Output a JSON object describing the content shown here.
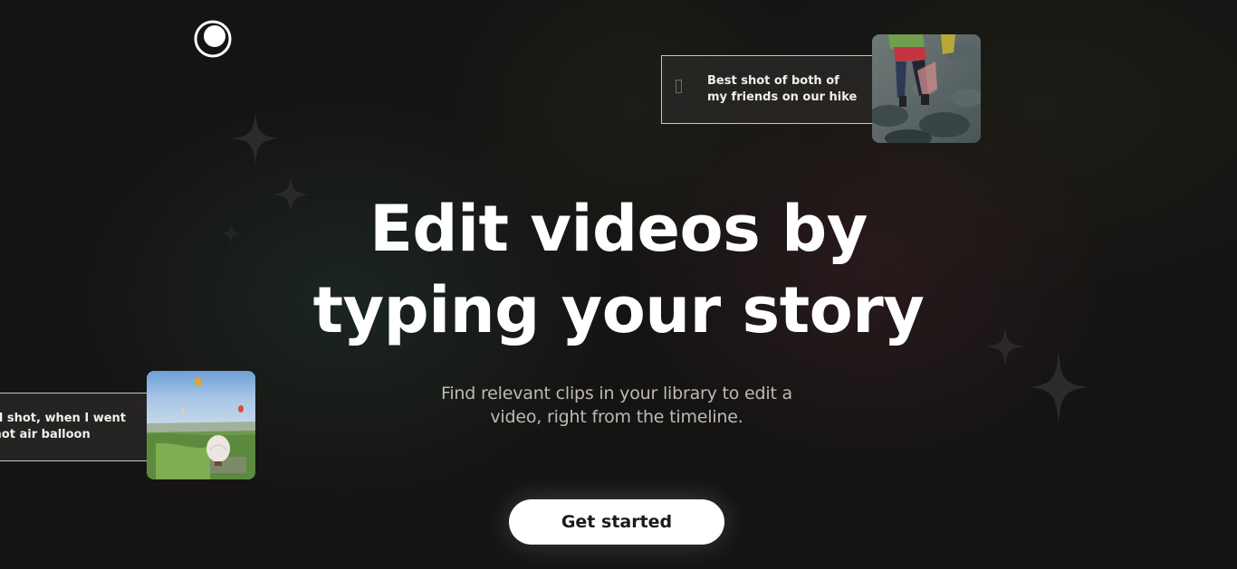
{
  "logo": {
    "icon": "brand-logo-icon"
  },
  "hero": {
    "headline_line1": "Edit videos by",
    "headline_line2": "typing your story",
    "subtitle": "Find relevant clips in your library to edit a video, right from the timeline.",
    "cta_label": "Get started"
  },
  "cards": [
    {
      "line1": "Best shot of both of",
      "line2": "my friends on our hike",
      "thumbnail": "hikers-on-rocks-thumbnail"
    },
    {
      "line1": "rial shot, when I went",
      "line2": "a hot air balloon",
      "thumbnail": "hot-air-balloon-thumbnail"
    }
  ],
  "colors": {
    "background": "#151413",
    "cta_background": "#ffffff",
    "cta_text": "#1b1b1b",
    "subtitle": "#bdbab6",
    "card_border": "#c9c7c4"
  }
}
